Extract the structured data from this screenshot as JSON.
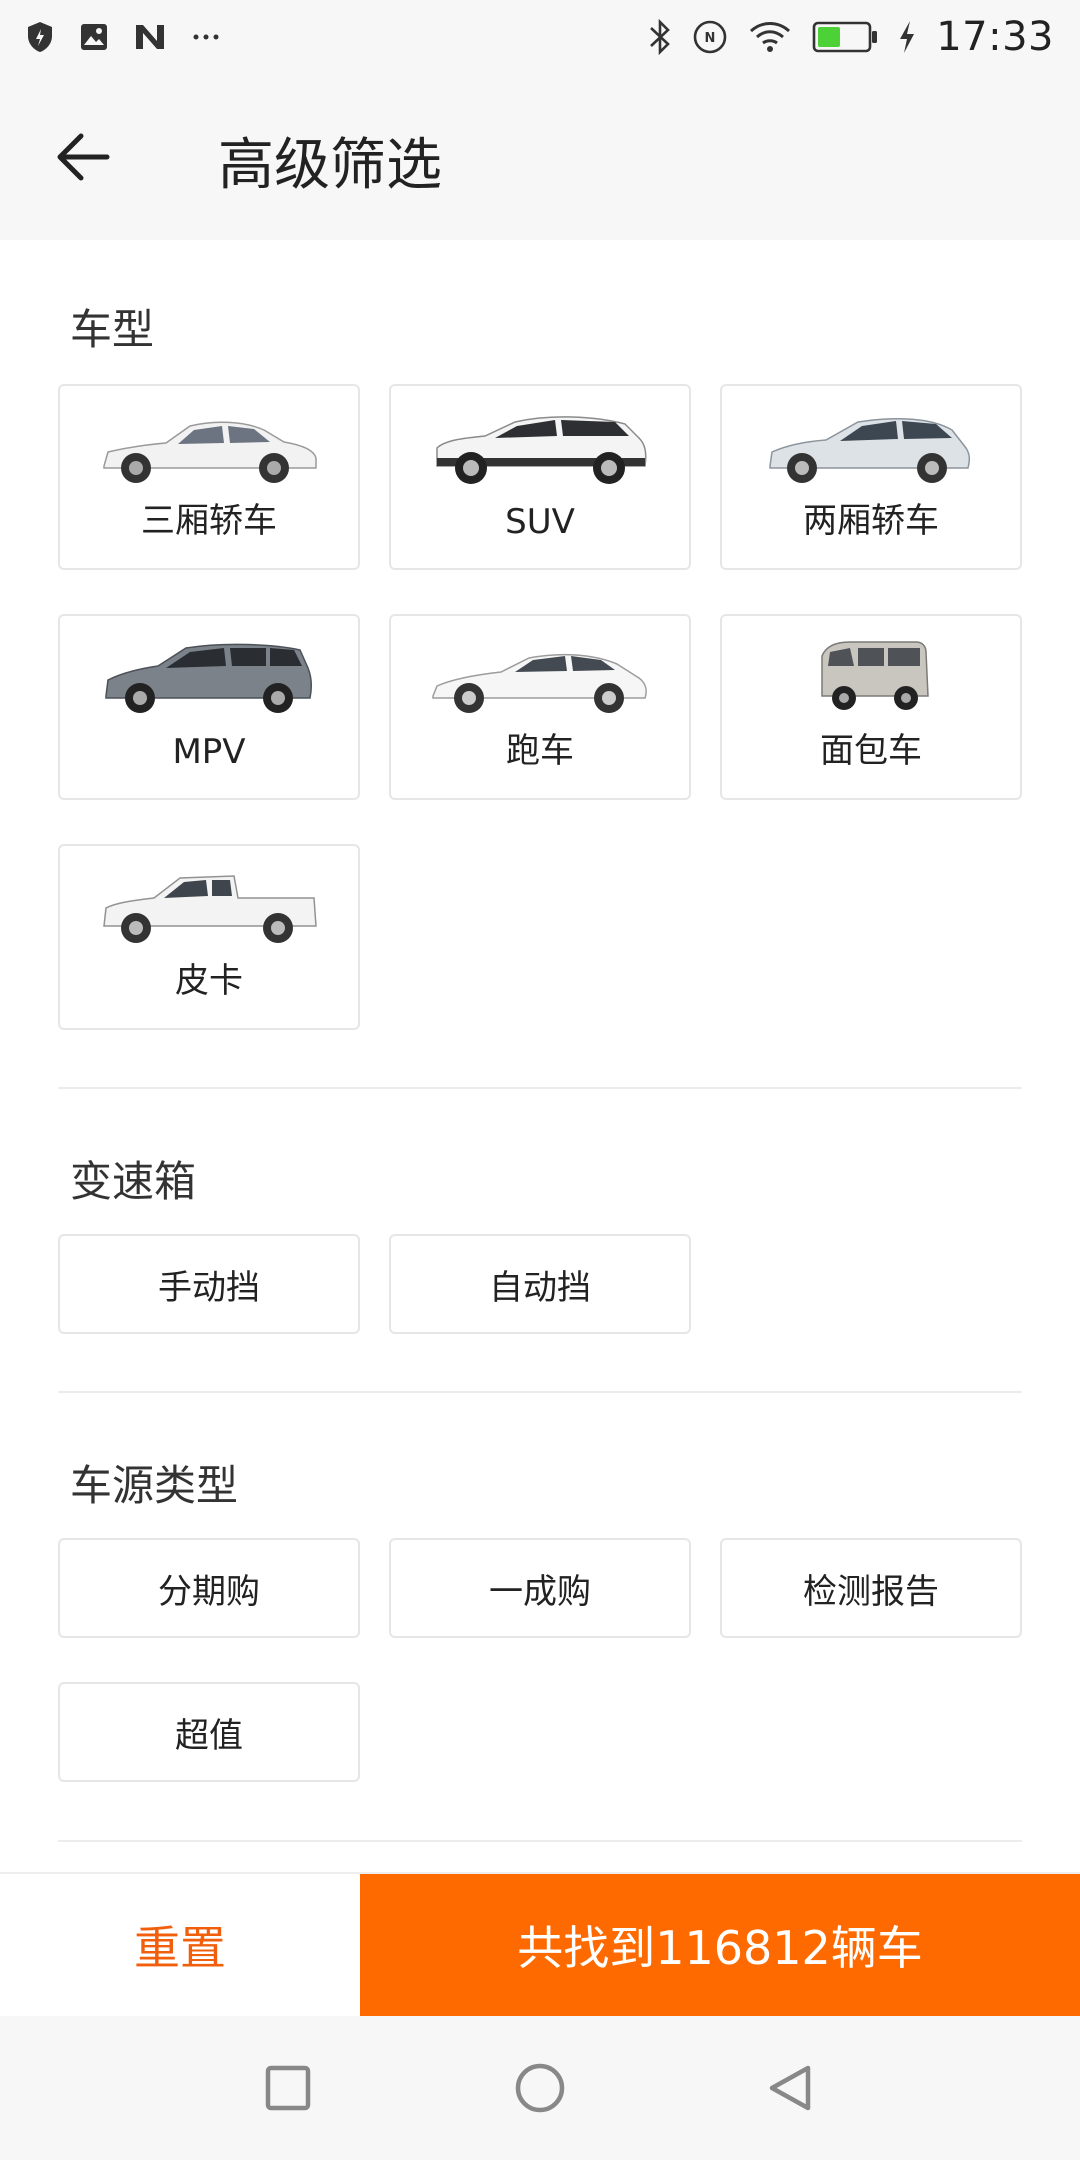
{
  "status_bar": {
    "time": "17:33",
    "icons": [
      "shield-icon",
      "image-icon",
      "n-logo-icon",
      "more-icon",
      "bluetooth-icon",
      "nfc-icon",
      "wifi-icon",
      "battery-icon",
      "charging-icon"
    ],
    "battery_level": 0.45,
    "battery_color": "#4cd137"
  },
  "header": {
    "title": "高级筛选"
  },
  "sections": {
    "car_type": {
      "title": "车型",
      "options": [
        "三厢轿车",
        "SUV",
        "两厢轿车",
        "MPV",
        "跑车",
        "面包车",
        "皮卡"
      ]
    },
    "transmission": {
      "title": "变速箱",
      "options": [
        "手动挡",
        "自动挡"
      ]
    },
    "source_type": {
      "title": "车源类型",
      "options": [
        "分期购",
        "一成购",
        "检测报告",
        "超值"
      ]
    }
  },
  "actions": {
    "reset_label": "重置",
    "search_label": "共找到116812辆车"
  },
  "colors": {
    "accent": "#ff6a00",
    "reset_text": "#f25f0c",
    "border": "#e6e6e6",
    "header_bg": "#f7f7f7"
  }
}
